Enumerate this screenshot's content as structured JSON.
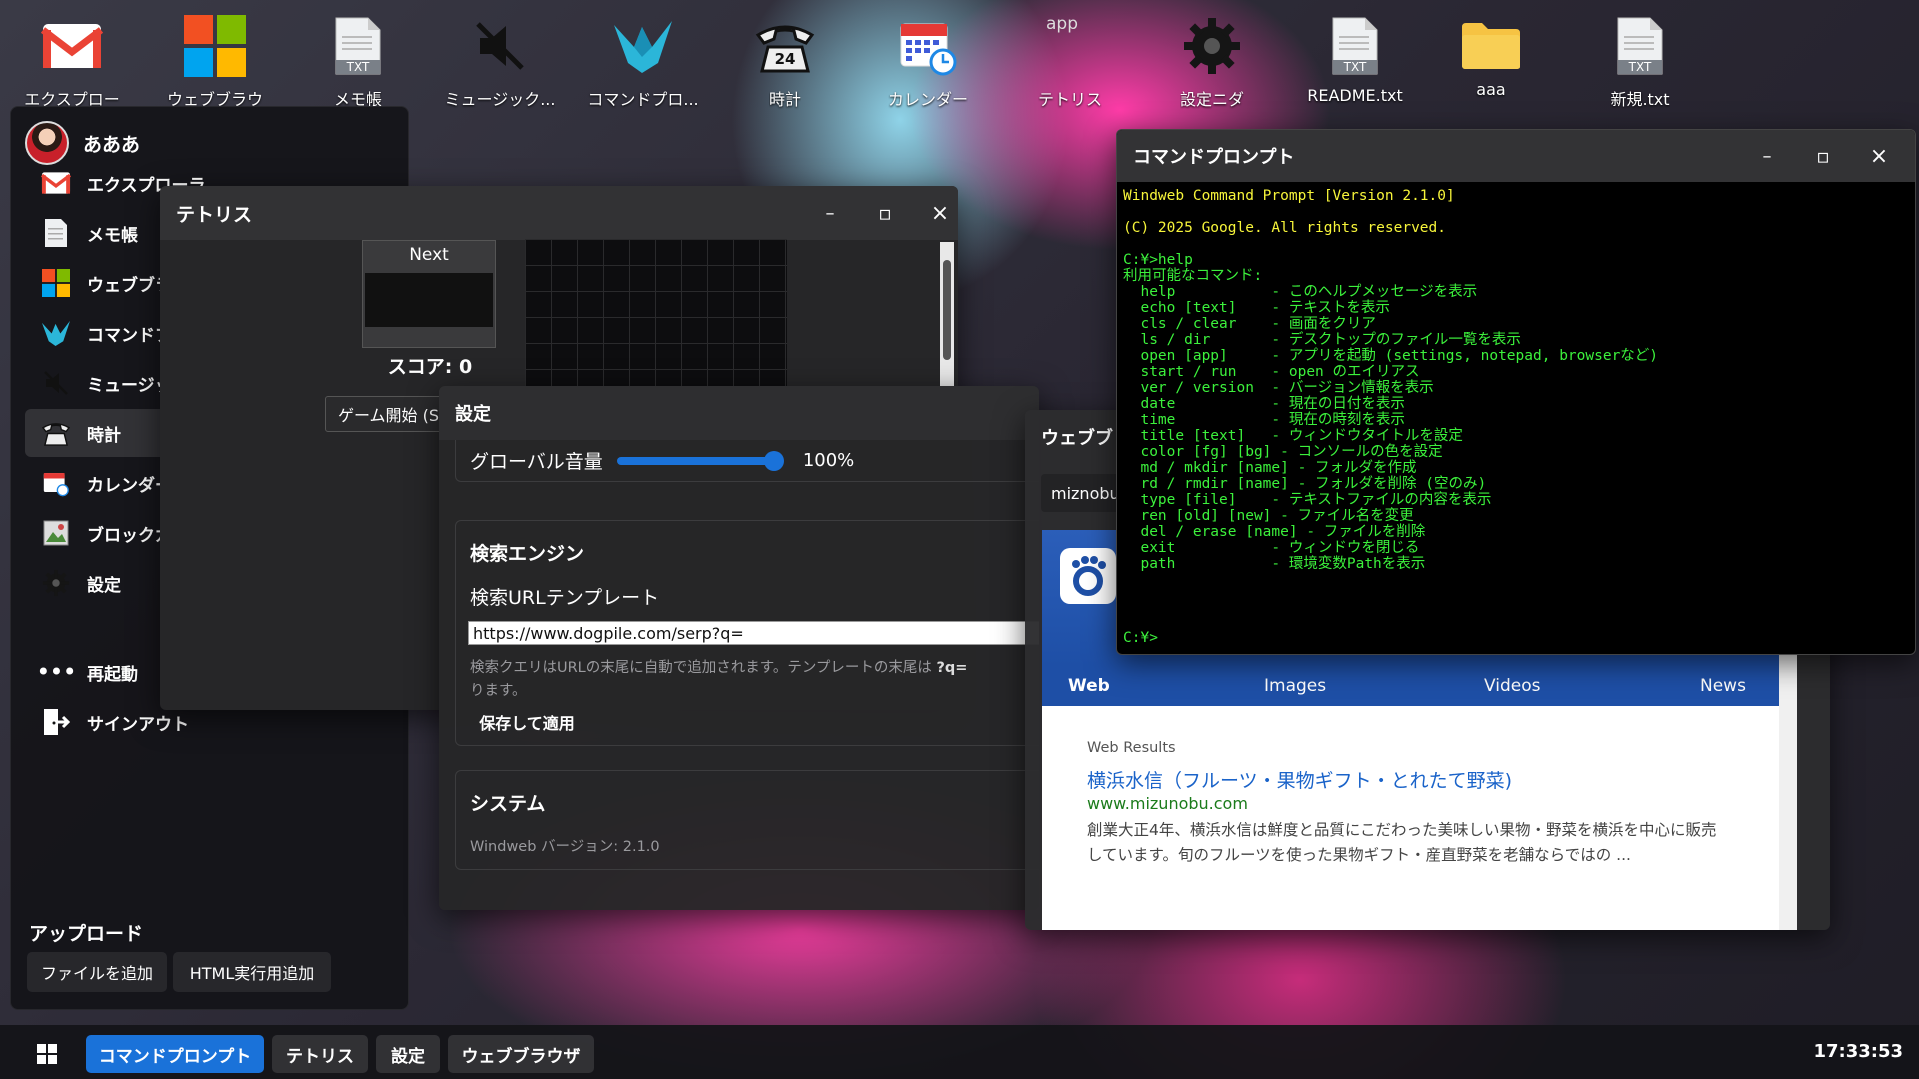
{
  "desktop": {
    "icons": [
      {
        "label": "エクスプロー",
        "icon": "gmail-icon"
      },
      {
        "label": "ウェブブラウ",
        "icon": "windows-logo-icon"
      },
      {
        "label": "メモ帳",
        "icon": "txt-file-icon"
      },
      {
        "label": "ミュージック...",
        "icon": "muted-speaker-icon"
      },
      {
        "label": "コマンドプロ...",
        "icon": "bird-icon"
      },
      {
        "label": "時計",
        "icon": "telephone-24-icon"
      },
      {
        "label": "カレンダー",
        "icon": "calendar-clock-icon"
      },
      {
        "label": "テトリス",
        "icon": "broken-image-icon",
        "alt": "app"
      },
      {
        "label": "設定ニダ",
        "icon": "gear-icon"
      },
      {
        "label": "README.txt",
        "icon": "txt-file-icon"
      },
      {
        "label": "aaa",
        "icon": "folder-icon"
      },
      {
        "label": "新規.txt",
        "icon": "txt-file-icon"
      }
    ]
  },
  "start_menu": {
    "user": "あああ",
    "items": [
      {
        "label": "エクスプローラ",
        "icon": "gmail-icon"
      },
      {
        "label": "メモ帳",
        "icon": "notepad-icon"
      },
      {
        "label": "ウェブブラウザ",
        "icon": "windows-logo-icon"
      },
      {
        "label": "コマンドプロンプト",
        "icon": "bird-icon"
      },
      {
        "label": "ミュージック",
        "icon": "muted-speaker-icon"
      },
      {
        "label": "時計",
        "icon": "telephone-24-icon"
      },
      {
        "label": "カレンダー",
        "icon": "calendar-clock-icon"
      },
      {
        "label": "ブロックガ",
        "icon": "image-icon"
      },
      {
        "label": "設定",
        "icon": "gear-icon"
      }
    ],
    "restart": "再起動",
    "signout": "サインアウト",
    "upload_title": "アップロード",
    "upload_buttons": [
      "ファイルを追加",
      "HTML実行用追加"
    ]
  },
  "tetris": {
    "title": "テトリス",
    "next_label": "Next",
    "score": "スコア: 0",
    "start_button": "ゲーム開始 (S"
  },
  "settings": {
    "title": "設定",
    "volume": {
      "label": "グローバル音量",
      "value": "100%",
      "level": 1.0
    },
    "search": {
      "title": "検索エンジン",
      "template_label": "検索URLテンプレート",
      "template_value": "https://www.dogpile.com/serp?q=",
      "note_prefix": "検索クエリはURLの末尾に自動で追加されます。テンプレートの末尾は ",
      "note_bold": "?q=",
      "note_rest": " ",
      "note_line2": "ります。",
      "save_button": "保存して適用"
    },
    "system": {
      "title": "システム",
      "version": "Windweb バージョン: 2.1.0"
    }
  },
  "browser": {
    "title": "ウェブブ",
    "url_partial": "miznobu",
    "tabs": [
      "Web",
      "Images",
      "Videos",
      "News"
    ],
    "results_label": "Web Results",
    "result": {
      "title": "横浜水信（フルーツ・果物ギフト・とれたて野菜)",
      "url": "www.mizunobu.com",
      "snippet": "創業大正4年、横浜水信は鮮度と品質にこだわった美味しい果物・野菜を横浜を中心に販売しています。旬のフルーツを使った果物ギフト・産直野菜を老舗ならではの ..."
    }
  },
  "cmd": {
    "title": "コマンドプロンプト",
    "header1": "Windweb Command Prompt [Version 2.1.0]",
    "header2": "(C) 2025 Google. All rights reserved.",
    "command": "C:¥>help",
    "available": "利用可能なコマンド:",
    "commands": [
      "  help           - このヘルプメッセージを表示",
      "  echo [text]    - テキストを表示",
      "  cls / clear    - 画面をクリア",
      "  ls / dir       - デスクトップのファイル一覧を表示",
      "  open [app]     - アプリを起動 (settings, notepad, browserなど)",
      "  start / run    - open のエイリアス",
      "  ver / version  - バージョン情報を表示",
      "  date           - 現在の日付を表示",
      "  time           - 現在の時刻を表示",
      "  title [text]   - ウィンドウタイトルを設定",
      "  color [fg] [bg] - コンソールの色を設定",
      "  md / mkdir [name] - フォルダを作成",
      "  rd / rmdir [name] - フォルダを削除 (空のみ)",
      "  type [file]    - テキストファイルの内容を表示",
      "  ren [old] [new] - ファイル名を変更",
      "  del / erase [name] - ファイルを削除",
      "  exit           - ウィンドウを閉じる",
      "  path           - 環境変数Pathを表示"
    ],
    "prompt": "C:¥>"
  },
  "window_controls": {
    "minimize": "–",
    "maximize": "▫",
    "close": "×"
  },
  "taskbar": {
    "apps": [
      "コマンドプロンプト",
      "テトリス",
      "設定",
      "ウェブブラウザ"
    ],
    "active": "コマンドプロンプト",
    "clock": "17:33:53"
  },
  "colors": {
    "accent": "#1a72d9",
    "cmd_green": "#3cf13c",
    "cmd_yellow": "#f7f53a",
    "browser_header": "#1e4fa6",
    "link": "#1a63c9",
    "url_green": "#1b7b1b"
  }
}
